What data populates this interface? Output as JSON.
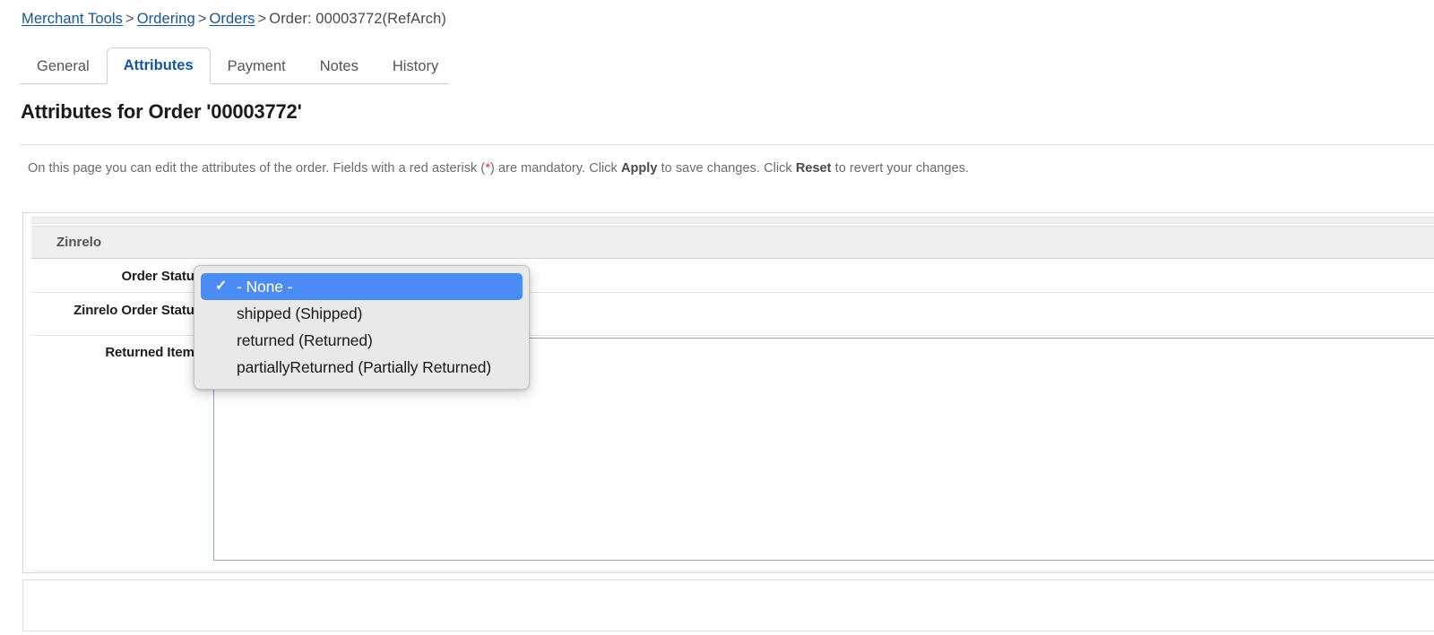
{
  "breadcrumb": {
    "items": [
      {
        "label": "Merchant Tools",
        "link": true
      },
      {
        "label": "Ordering",
        "link": true
      },
      {
        "label": "Orders",
        "link": true
      },
      {
        "label": "Order: 00003772(RefArch)",
        "link": false
      }
    ],
    "separator": ">"
  },
  "tabs": [
    {
      "label": "General",
      "active": false
    },
    {
      "label": "Attributes",
      "active": true
    },
    {
      "label": "Payment",
      "active": false
    },
    {
      "label": "Notes",
      "active": false
    },
    {
      "label": "History",
      "active": false
    }
  ],
  "page": {
    "title": "Attributes for Order '00003772'",
    "intro": {
      "part1": "On this page you can edit the attributes of the order. Fields with a red asterisk (",
      "asterisk": "*",
      "part2": ") are mandatory. Click ",
      "apply": "Apply",
      "part3": " to save changes. Click ",
      "reset": "Reset",
      "part4": " to revert your changes."
    }
  },
  "form": {
    "group_title": "Zinrelo",
    "fields": {
      "order_status": {
        "label": "Order Status:",
        "value": "- None -"
      },
      "zinrelo_order_status": {
        "label": "Zinrelo Order Status:",
        "value": "",
        "placeholder": ""
      },
      "returned_items": {
        "label": "Returned Items:",
        "value": "",
        "placeholder": ""
      }
    }
  },
  "dropdown": {
    "open": true,
    "check_glyph": "✓",
    "options": [
      {
        "label": "- None -",
        "selected": true
      },
      {
        "label": "shipped (Shipped)",
        "selected": false
      },
      {
        "label": "returned (Returned)",
        "selected": false
      },
      {
        "label": "partiallyReturned (Partially Returned)",
        "selected": false
      }
    ]
  },
  "colors": {
    "link": "#15569b",
    "active_tab_text": "#14579e",
    "selection_blue": "#4a8bf4",
    "required_red": "#e03030",
    "panel_header_bg": "#eeeeee"
  }
}
